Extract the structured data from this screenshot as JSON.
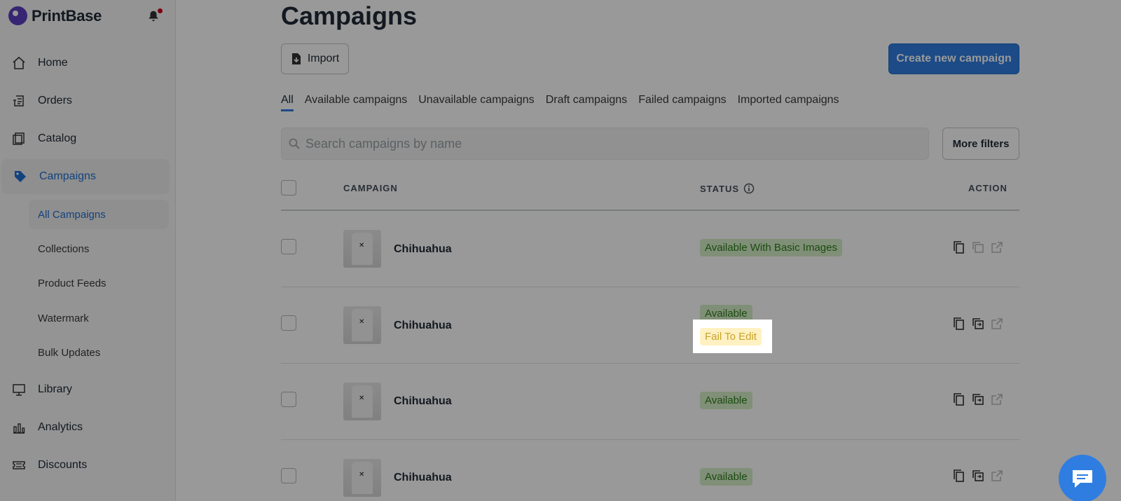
{
  "brand": {
    "name": "PrintBase"
  },
  "sidebar": {
    "items": [
      {
        "label": "Home",
        "icon": "home-icon"
      },
      {
        "label": "Orders",
        "icon": "orders-icon"
      },
      {
        "label": "Catalog",
        "icon": "catalog-icon"
      },
      {
        "label": "Campaigns",
        "icon": "tag-icon",
        "active": true
      },
      {
        "label": "Library",
        "icon": "monitor-icon"
      },
      {
        "label": "Analytics",
        "icon": "bar-chart-icon"
      },
      {
        "label": "Discounts",
        "icon": "ticket-icon"
      }
    ],
    "sub_items": [
      {
        "label": "All Campaigns",
        "active": true
      },
      {
        "label": "Collections"
      },
      {
        "label": "Product Feeds"
      },
      {
        "label": "Watermark"
      },
      {
        "label": "Bulk Updates"
      }
    ]
  },
  "page": {
    "title": "Campaigns",
    "import_label": "Import",
    "create_label": "Create new campaign",
    "tabs": [
      {
        "label": "All",
        "active": true
      },
      {
        "label": "Available campaigns"
      },
      {
        "label": "Unavailable campaigns"
      },
      {
        "label": "Draft campaigns"
      },
      {
        "label": "Failed campaigns"
      },
      {
        "label": "Imported campaigns"
      }
    ],
    "search_placeholder": "Search campaigns by name",
    "more_filters_label": "More filters"
  },
  "table": {
    "columns": {
      "campaign": "CAMPAIGN",
      "status": "STATUS",
      "action": "ACTION"
    },
    "rows": [
      {
        "name": "Chihuahua",
        "statuses": [
          "Available With Basic Images"
        ]
      },
      {
        "name": "Chihuahua",
        "statuses": [
          "Available",
          "Fail To Edit"
        ]
      },
      {
        "name": "Chihuahua",
        "statuses": [
          "Available"
        ]
      },
      {
        "name": "Chihuahua",
        "statuses": [
          "Available"
        ]
      }
    ]
  },
  "colors": {
    "accent": "#2f7de1",
    "status_green": "#2e7d1d",
    "status_warning": "#c9a227"
  }
}
